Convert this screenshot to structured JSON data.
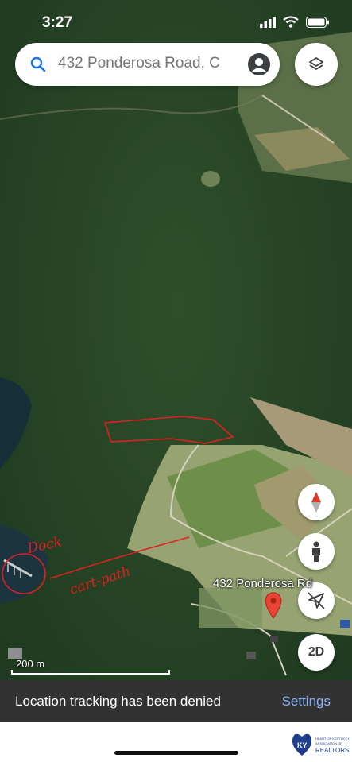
{
  "status_bar": {
    "time": "3:27"
  },
  "search": {
    "query": "432 Ponderosa Road, C"
  },
  "map": {
    "place_label": "432 Ponderosa Rd",
    "scale_label": "200 m",
    "annotations": [
      "Dock",
      "cart path"
    ]
  },
  "controls": {
    "two_d_label": "2D"
  },
  "toast": {
    "message": "Location tracking has been denied",
    "action": "Settings"
  },
  "logo": {
    "text": [
      "HEART OF KENTUCKY",
      "ASSOCIATION OF",
      "REALTORS"
    ],
    "initials": "KY"
  },
  "colors": {
    "accent": "#1a73e8",
    "annotation": "#e02020",
    "pin": "#ea4335",
    "toast_action": "#8ab4f8"
  }
}
